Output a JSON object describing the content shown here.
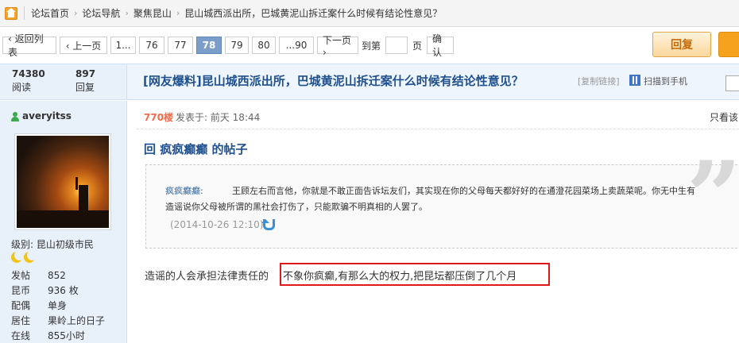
{
  "breadcrumb": {
    "items": [
      "论坛首页",
      "论坛导航",
      "聚焦昆山"
    ],
    "current": "昆山城西派出所，巴城黄泥山拆迁案什么时候有结论性意见？",
    "separator": "›"
  },
  "pager": {
    "back_label": "‹ 返回列表",
    "prev_label": "‹ 上一页",
    "pages": [
      "1...",
      "76",
      "77",
      "78",
      "79",
      "80",
      "...90"
    ],
    "current_page": "78",
    "next_label": "下一页 ›",
    "goto_label": "到第",
    "page_unit": "页",
    "confirm_label": "确认",
    "reply_label": "回复"
  },
  "thread": {
    "views": "74380",
    "views_label": "阅读",
    "replies": "897",
    "replies_label": "回复",
    "title": "[网友爆料]昆山城西派出所，巴城黄泥山拆迁案什么时候有结论性意见？",
    "copy_link": "[复制链接]",
    "scan_label": "扫描到手机"
  },
  "user": {
    "name": "averyitss",
    "level": "级别: 昆山初级市民",
    "profile": [
      {
        "key": "发帖",
        "value": "852"
      },
      {
        "key": "昆币",
        "value": "936 枚"
      },
      {
        "key": "配偶",
        "value": "单身"
      },
      {
        "key": "居住",
        "value": "果岭上的日子"
      },
      {
        "key": "在线",
        "value": "855小时"
      }
    ]
  },
  "post": {
    "floor": "770楼",
    "time": "发表于: 前天 18:44",
    "only_author": "只看该",
    "reply_heading": "回 疯疯癫癫 的帖子",
    "quote": {
      "author": "疯疯癫癫:",
      "line1": "王顾左右而言他，你就是不敢正面告诉坛友们，其实现在你的父母每天都好好的在通澄花园菜场上卖蔬菜呢。你无中生有",
      "line2": "造谣说你父母被所谓的黑社会打伤了，只能欺骗不明真相的人罢了。",
      "time": "(2014-10-26 12:10)"
    },
    "body_prefix": "造谣的人会承担法律责任的",
    "body_highlight": "不象你疯癫,有那么大的权力,把昆坛都压倒了几个月"
  },
  "colors": {
    "title_blue": "#20518f",
    "accent_orange": "#f5a31f",
    "floor_red": "#f26c4f",
    "highlight_red": "#e01818",
    "current_page_bg": "#7a9ec9"
  }
}
